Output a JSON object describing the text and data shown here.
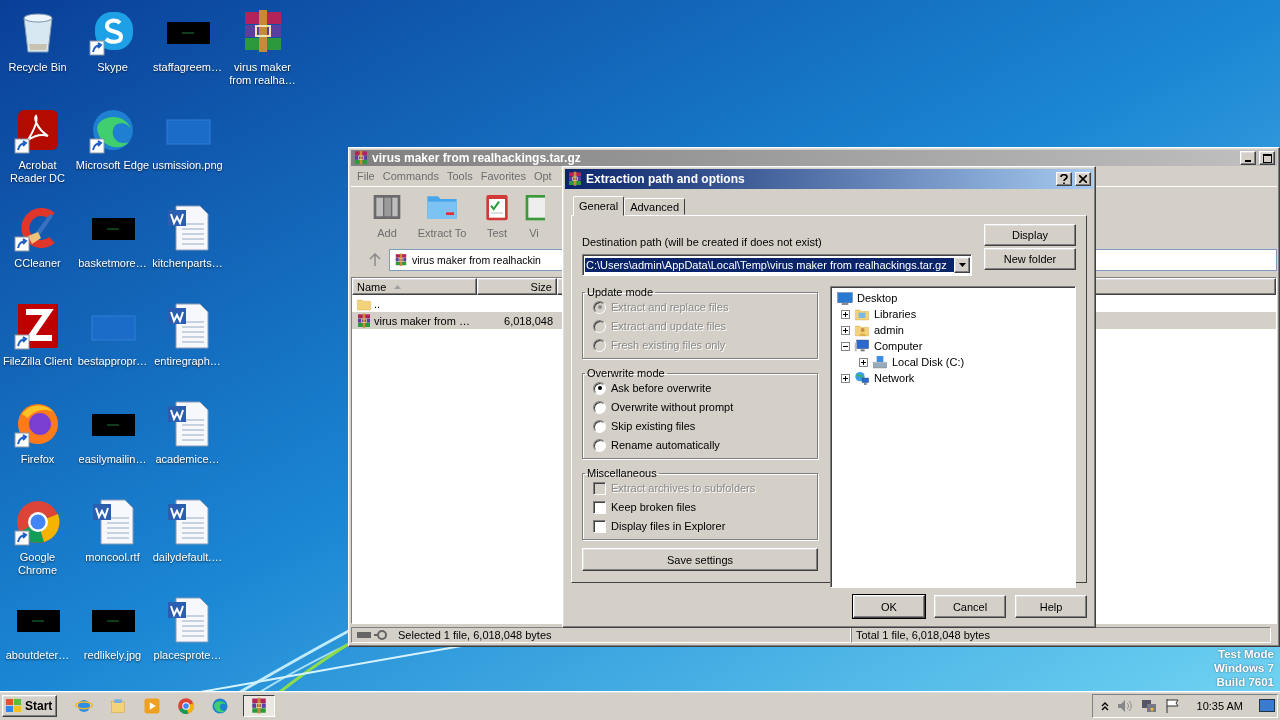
{
  "desktop": {
    "icons": [
      {
        "label": "Recycle Bin",
        "kind": "recycle",
        "shortcut": false
      },
      {
        "label": "Acrobat Reader DC",
        "kind": "acrobat",
        "shortcut": true
      },
      {
        "label": "CCleaner",
        "kind": "ccleaner",
        "shortcut": true
      },
      {
        "label": "FileZilla Client",
        "kind": "filezilla",
        "shortcut": true
      },
      {
        "label": "Firefox",
        "kind": "firefox",
        "shortcut": true
      },
      {
        "label": "Google Chrome",
        "kind": "chrome",
        "shortcut": true
      },
      {
        "label": "aboutdeter…",
        "kind": "thumb",
        "shortcut": false
      },
      {
        "label": "Skype",
        "kind": "skype",
        "shortcut": true
      },
      {
        "label": "Microsoft Edge",
        "kind": "edge",
        "shortcut": true
      },
      {
        "label": "basketmore…",
        "kind": "thumb",
        "shortcut": false
      },
      {
        "label": "bestappropr…",
        "kind": "blank",
        "shortcut": false
      },
      {
        "label": "easilymailin…",
        "kind": "thumb",
        "shortcut": false
      },
      {
        "label": "moncool.rtf",
        "kind": "word",
        "shortcut": false
      },
      {
        "label": "redlikely.jpg",
        "kind": "thumb",
        "shortcut": false
      },
      {
        "label": "staffagreem…",
        "kind": "thumb",
        "shortcut": false
      },
      {
        "label": "usmission.png",
        "kind": "blank",
        "shortcut": false
      },
      {
        "label": "kitchenparts…",
        "kind": "word",
        "shortcut": false
      },
      {
        "label": "entiregraph…",
        "kind": "word",
        "shortcut": false
      },
      {
        "label": "academice…",
        "kind": "word",
        "shortcut": false
      },
      {
        "label": "dailydefault.…",
        "kind": "word",
        "shortcut": false
      },
      {
        "label": "placesprote…",
        "kind": "word",
        "shortcut": false
      },
      {
        "label": "virus maker from realha…",
        "kind": "winrar",
        "shortcut": false
      }
    ],
    "system_notice": [
      "Test Mode",
      "Windows 7",
      "Build 7601"
    ]
  },
  "archiver_window": {
    "title": "virus maker from realhackings.tar.gz",
    "menu": [
      "File",
      "Commands",
      "Tools",
      "Favorites",
      "Opt"
    ],
    "toolbar": [
      {
        "label": "Add",
        "kind": "add"
      },
      {
        "label": "Extract To",
        "kind": "extract"
      },
      {
        "label": "Test",
        "kind": "test"
      },
      {
        "label": "Vi",
        "kind": "view"
      }
    ],
    "address": "virus maker from realhackin",
    "columns": [
      "Name",
      "Size"
    ],
    "rows": [
      {
        "name": "..",
        "kind": "folder",
        "selected": false
      },
      {
        "name": "virus maker from …",
        "size": "6,018,048",
        "kind": "archive",
        "selected": true
      }
    ],
    "status_left": "Selected 1 file, 6,018,048 bytes",
    "status_right": "Total 1 file, 6,018,048 bytes"
  },
  "dialog": {
    "title": "Extraction path and options",
    "tabs": [
      {
        "label": "General",
        "selected": true
      },
      {
        "label": "Advanced",
        "selected": false
      }
    ],
    "path_label": "Destination path (will be created if does not exist)",
    "path_value": "C:\\Users\\admin\\AppData\\Local\\Temp\\virus maker from realhackings.tar.gz",
    "side_buttons": [
      "Display",
      "New folder"
    ],
    "groups": [
      {
        "title": "Update mode",
        "kind": "radio",
        "options": [
          {
            "label": "Extract and replace files",
            "checked": true,
            "disabled": true
          },
          {
            "label": "Extract and update files",
            "checked": false,
            "disabled": true
          },
          {
            "label": "Fresh existing files only",
            "checked": false,
            "disabled": true
          }
        ]
      },
      {
        "title": "Overwrite mode",
        "kind": "radio",
        "options": [
          {
            "label": "Ask before overwrite",
            "checked": true,
            "disabled": false
          },
          {
            "label": "Overwrite without prompt",
            "checked": false,
            "disabled": false
          },
          {
            "label": "Skip existing files",
            "checked": false,
            "disabled": false
          },
          {
            "label": "Rename automatically",
            "checked": false,
            "disabled": false
          }
        ]
      },
      {
        "title": "Miscellaneous",
        "kind": "checkbox",
        "options": [
          {
            "label": "Extract archives to subfolders",
            "checked": false,
            "disabled": true
          },
          {
            "label": "Keep broken files",
            "checked": false,
            "disabled": false
          },
          {
            "label": "Display files in Explorer",
            "checked": false,
            "disabled": false
          }
        ]
      }
    ],
    "save_button": "Save settings",
    "tree": [
      {
        "label": "Desktop",
        "kind": "desktop",
        "children": [
          {
            "label": "Libraries",
            "kind": "libraries",
            "expanded": false
          },
          {
            "label": "admin",
            "kind": "user",
            "expanded": false
          },
          {
            "label": "Computer",
            "kind": "computer",
            "expanded": true,
            "children": [
              {
                "label": "Local Disk (C:)",
                "kind": "disk",
                "expanded": false
              }
            ]
          },
          {
            "label": "Network",
            "kind": "network",
            "expanded": false
          }
        ]
      }
    ],
    "buttons": [
      "OK",
      "Cancel",
      "Help"
    ]
  },
  "taskbar": {
    "start": "Start",
    "apps": [
      {
        "kind": "ie",
        "selected": false
      },
      {
        "kind": "explorer",
        "selected": false
      },
      {
        "kind": "media",
        "selected": false
      },
      {
        "kind": "chrome",
        "selected": false
      },
      {
        "kind": "edge",
        "selected": false
      },
      {
        "kind": "winrar",
        "selected": true
      }
    ],
    "clock": "10:35 AM"
  }
}
